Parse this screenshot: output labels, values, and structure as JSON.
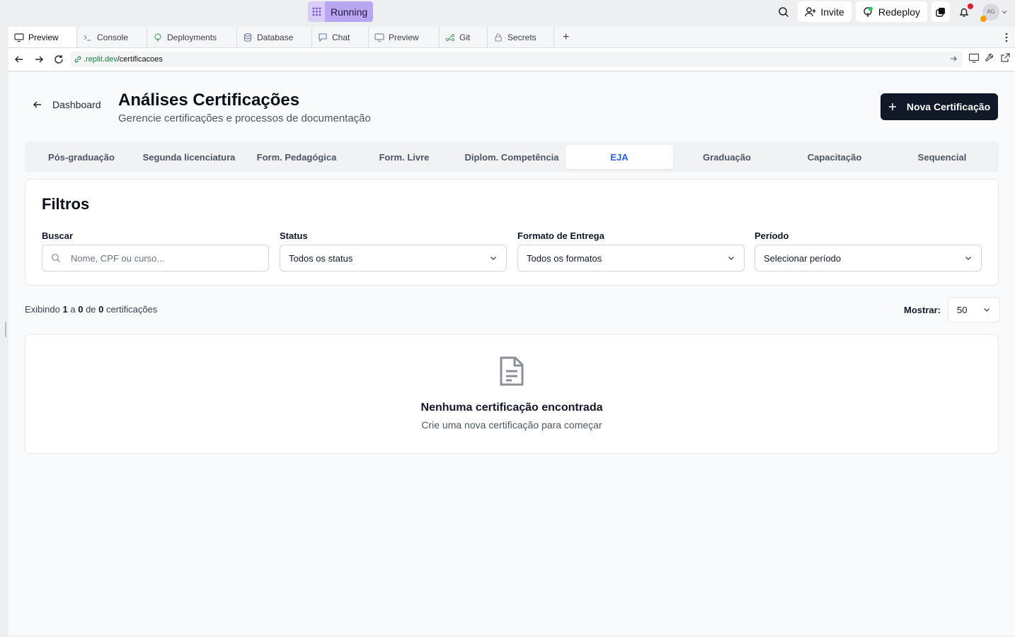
{
  "topbar": {
    "status_label": "Running",
    "invite_label": "Invite",
    "redeploy_label": "Redeploy",
    "avatar_initials": "AG"
  },
  "ide_tabs": [
    {
      "label": "Preview",
      "icon": "monitor-icon",
      "active": true
    },
    {
      "label": "Console",
      "icon": "terminal-icon"
    },
    {
      "label": "Deployments",
      "icon": "deploy-icon"
    },
    {
      "label": "Database",
      "icon": "database-icon"
    },
    {
      "label": "Chat",
      "icon": "chat-icon"
    },
    {
      "label": "Preview",
      "icon": "monitor-icon"
    },
    {
      "label": "Git",
      "icon": "git-icon"
    },
    {
      "label": "Secrets",
      "icon": "lock-icon"
    }
  ],
  "url": {
    "host": ".replit.dev",
    "path": "/certificacoes"
  },
  "header": {
    "back_label": "Dashboard",
    "title": "Análises Certificações",
    "subtitle": "Gerencie certificações e processos de documentação",
    "new_button_label": "Nova Certificação"
  },
  "category_tabs": [
    {
      "label": "Pós-graduação"
    },
    {
      "label": "Segunda licenciatura"
    },
    {
      "label": "Form. Pedagógica"
    },
    {
      "label": "Form. Livre"
    },
    {
      "label": "Diplom. Competência"
    },
    {
      "label": "EJA",
      "active": true
    },
    {
      "label": "Graduação"
    },
    {
      "label": "Capacitação"
    },
    {
      "label": "Sequencial"
    }
  ],
  "filters": {
    "title": "Filtros",
    "search_label": "Buscar",
    "search_placeholder": "Nome, CPF ou curso...",
    "status_label": "Status",
    "status_value": "Todos os status",
    "format_label": "Formato de Entrega",
    "format_value": "Todos os formatos",
    "period_label": "Período",
    "period_value": "Selecionar período"
  },
  "results": {
    "prefix": "Exibindo",
    "from": "1",
    "a": "a",
    "to": "0",
    "de": "de",
    "total": "0",
    "suffix": "certificações",
    "show_label": "Mostrar:",
    "page_size": "50"
  },
  "empty_state": {
    "title": "Nenhuma certificação encontrada",
    "subtitle": "Crie uma nova certificação para começar"
  },
  "colors": {
    "accent": "#2563eb",
    "primary_button": "#111827",
    "running": "#b9a6f2"
  }
}
